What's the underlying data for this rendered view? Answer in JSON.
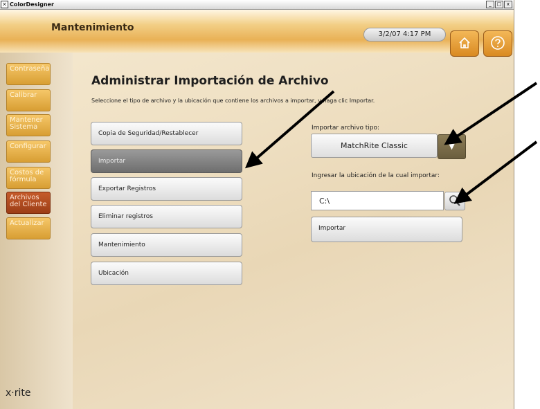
{
  "window": {
    "app_name": "ColorDesigner"
  },
  "header": {
    "title": "Mantenimiento",
    "datetime": "3/2/07 4:17 PM"
  },
  "sidebar": {
    "items": [
      {
        "label": "Contraseña"
      },
      {
        "label": "Calibrar"
      },
      {
        "label": "Mantener Sistema"
      },
      {
        "label": "Configurar"
      },
      {
        "label": "Costos de fórmula"
      },
      {
        "label": "Archivos del Cliente"
      },
      {
        "label": "Actualizar"
      }
    ],
    "active_index": 5,
    "logo": "x·rite"
  },
  "main": {
    "title": "Administrar Importación de Archivo",
    "instruction": "Seleccione el tipo de archivo y la ubicación que contiene los archivos a importar, y haga clic Importar.",
    "menu": [
      {
        "label": "Copia de Seguridad/Restablecer"
      },
      {
        "label": "Importar"
      },
      {
        "label": "Exportar Registros"
      },
      {
        "label": "Eliminar registros"
      },
      {
        "label": "Mantenimiento"
      },
      {
        "label": "Ubicación"
      }
    ],
    "active_menu_index": 1
  },
  "import_panel": {
    "type_label": "Importar archivo tipo:",
    "type_value": "MatchRite Classic",
    "location_label": "Ingresar la ubicación de la cual importar:",
    "path_value": "C:\\",
    "import_button": "Importar"
  },
  "colors": {
    "accent_orange": "#e3a03c",
    "active_red": "#b04b20",
    "dropdown_brown": "#7c6d49"
  },
  "icons": [
    "home-icon",
    "help-icon",
    "chevron-down-icon",
    "magnifier-icon"
  ]
}
